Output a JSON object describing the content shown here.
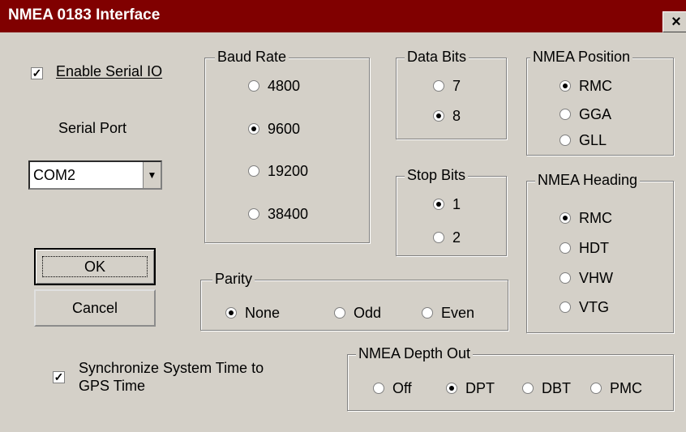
{
  "title": "NMEA 0183 Interface",
  "close_glyph": "×",
  "check_glyph": "✓",
  "dropdown_glyph": "▼",
  "enable_serial": {
    "label": "Enable Serial IO",
    "checked": true
  },
  "serial_port": {
    "label": "Serial Port",
    "value": "COM2"
  },
  "baud_rate": {
    "legend": "Baud Rate",
    "options": [
      "4800",
      "9600",
      "19200",
      "38400"
    ],
    "selected": "9600"
  },
  "data_bits": {
    "legend": "Data Bits",
    "options": [
      "7",
      "8"
    ],
    "selected": "8"
  },
  "stop_bits": {
    "legend": "Stop Bits",
    "options": [
      "1",
      "2"
    ],
    "selected": "1"
  },
  "nmea_position": {
    "legend": "NMEA Position",
    "options": [
      "RMC",
      "GGA",
      "GLL"
    ],
    "selected": "RMC"
  },
  "nmea_heading": {
    "legend": "NMEA Heading",
    "options": [
      "RMC",
      "HDT",
      "VHW",
      "VTG"
    ],
    "selected": "RMC"
  },
  "parity": {
    "legend": "Parity",
    "options": [
      "None",
      "Odd",
      "Even"
    ],
    "selected": "None"
  },
  "depth_out": {
    "legend": "NMEA Depth Out",
    "options": [
      "Off",
      "DPT",
      "DBT",
      "PMC"
    ],
    "selected": "DPT"
  },
  "buttons": {
    "ok": "OK",
    "cancel": "Cancel"
  },
  "sync_time": {
    "label_line1": "Synchronize System Time to",
    "label_line2": "GPS Time",
    "checked": true
  }
}
